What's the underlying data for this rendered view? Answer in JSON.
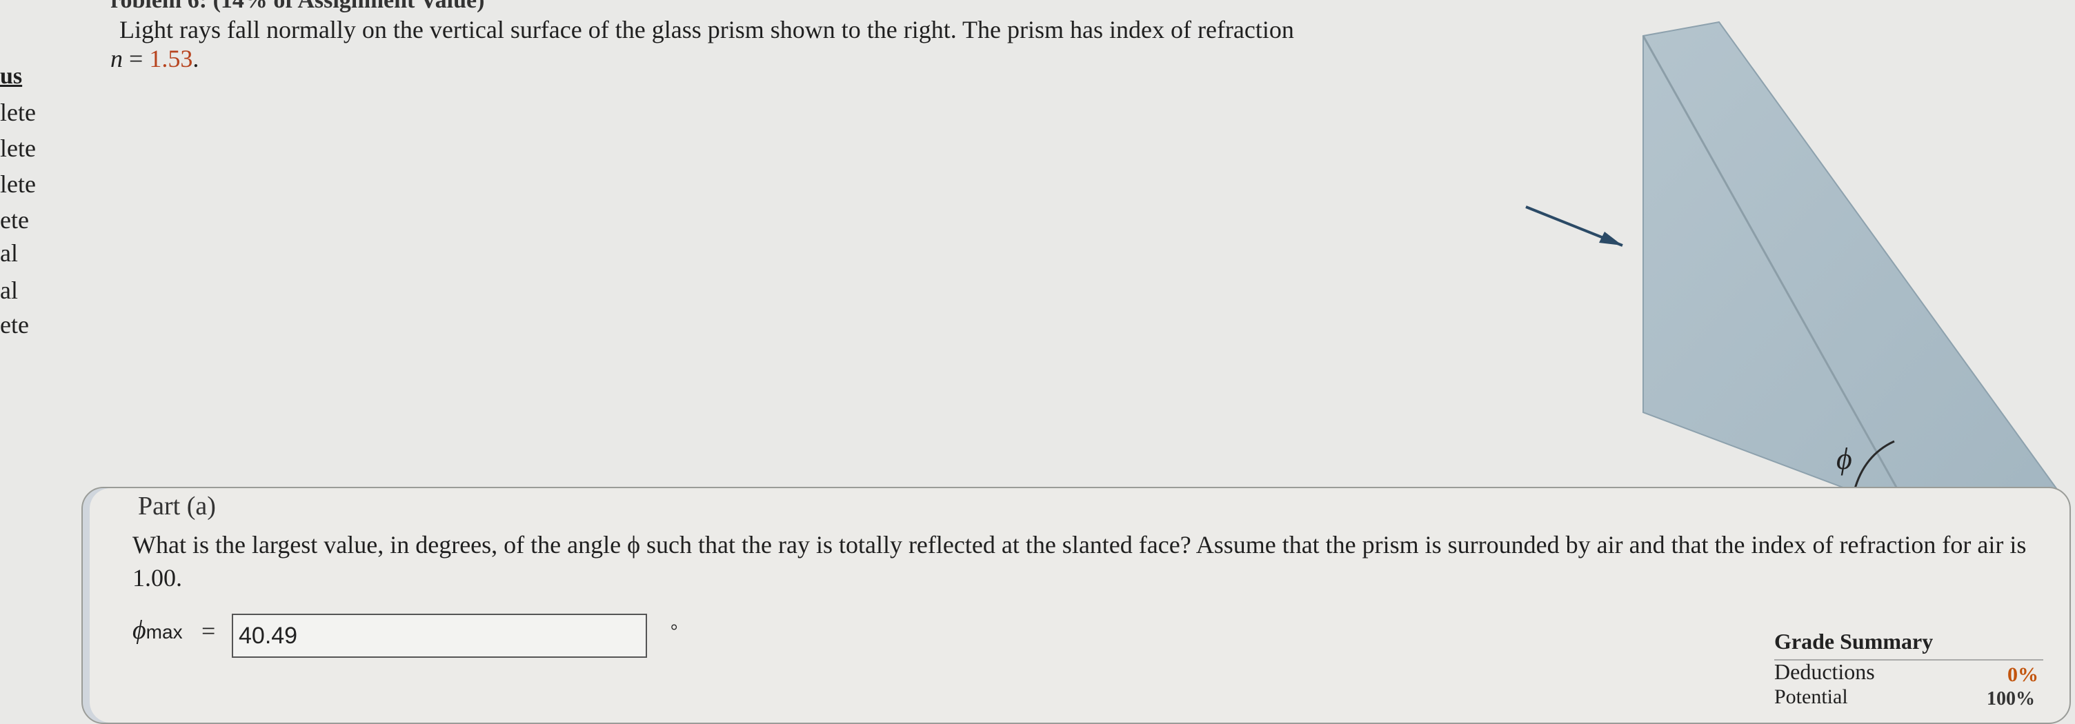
{
  "header": {
    "title": "roblem 6: (14% of Assignment Value)",
    "question": "Light rays fall normally on the vertical surface of the glass prism shown to the right. The prism has index of refraction",
    "n_var": "n",
    "n_eq": " = ",
    "n_value": "1.53",
    "n_end": "."
  },
  "sidebar": {
    "heading": "us",
    "items": [
      "lete",
      "lete",
      "lete",
      "ete",
      "al",
      "al",
      "ete"
    ]
  },
  "figure": {
    "angle_symbol": "ϕ",
    "prism_color": "#aebfc9",
    "arrow_color": "#2b4a66"
  },
  "part": {
    "title": "Part (a)",
    "question": "What is the largest value, in degrees, of the angle ϕ such that the ray is totally reflected at the slanted face? Assume that the prism is surrounded by air and that the index of refraction for air is 1.00.",
    "var_symbol": "ϕ",
    "var_sub": "max",
    "equals": "=",
    "answer_value": "40.49",
    "unit": "°"
  },
  "grade_summary": {
    "title": "Grade Summary",
    "deductions_label": "Deductions",
    "deductions_value": "0%",
    "potential_label": "Potential",
    "potential_value": "100%"
  }
}
